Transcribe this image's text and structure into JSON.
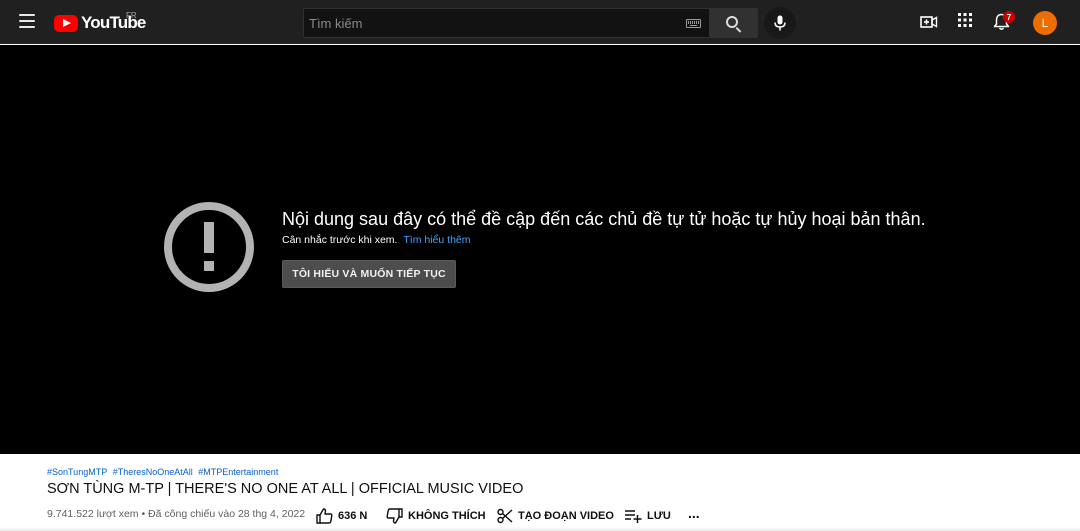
{
  "header": {
    "logo_text": "YouTube",
    "region": "FR",
    "search_placeholder": "Tìm kiếm",
    "notification_count": "7",
    "avatar_letter": "L"
  },
  "player": {
    "warning_title": "Nội dung sau đây có thể đề cập đến các chủ đề tự tử hoặc tự hủy hoại bản thân.",
    "warning_subtitle": "Cân nhắc trước khi xem.",
    "learn_more": "Tìm hiểu thêm",
    "continue_label": "TÔI HIỂU VÀ MUỐN TIẾP TỤC"
  },
  "video": {
    "hashtags": [
      "#SonTungMTP",
      "#TheresNoOneAtAll",
      "#MTPEntertainment"
    ],
    "title": "SƠN TÙNG M-TP | THERE'S NO ONE AT ALL | OFFICIAL MUSIC VIDEO",
    "meta": "9.741.522 lượt xem • Đã công chiếu vào 28 thg 4, 2022",
    "like_count": "636 N",
    "dislike_label": "KHÔNG THÍCH",
    "clip_label": "TẠO ĐOẠN VIDEO",
    "save_label": "LƯU",
    "more_label": "..."
  },
  "colors": {
    "header_bg": "#202020",
    "brand_red": "#ff0000",
    "link_blue": "#3ea6ff",
    "hashtag_blue": "#065fd4",
    "avatar_orange": "#ef6c00",
    "badge_red": "#cc0000"
  }
}
